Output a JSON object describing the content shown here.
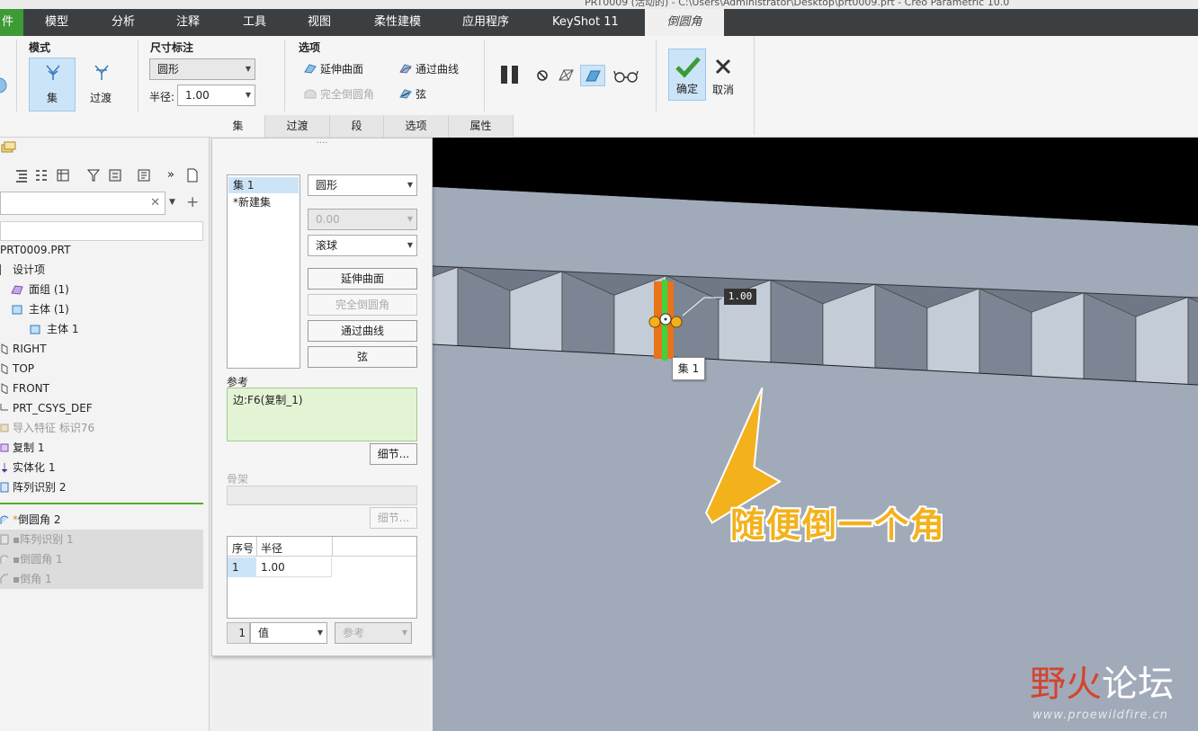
{
  "window": {
    "title": "PRT0009 (活动的) - C:\\Users\\Administrator\\Desktop\\prt0009.prt - Creo Parametric 10.0"
  },
  "menu": {
    "file": "件",
    "tabs": [
      "模型",
      "分析",
      "注释",
      "工具",
      "视图",
      "柔性建模",
      "应用程序",
      "KeyShot 11"
    ],
    "active_tab": "倒圆角"
  },
  "ribbon": {
    "mode": {
      "title": "模式",
      "set_label": "集",
      "transition_label": "过渡"
    },
    "dimension": {
      "title": "尺寸标注",
      "shape_value": "圆形",
      "radius_label": "半径:",
      "radius_value": "1.00"
    },
    "options": {
      "title": "选项",
      "extend_surface": "延伸曲面",
      "through_curve": "通过曲线",
      "full_round": "完全倒圆角",
      "chord": "弦"
    },
    "confirm_label": "确定",
    "cancel_label": "取消",
    "subtabs": [
      "集",
      "过渡",
      "段",
      "选项",
      "属性"
    ]
  },
  "tree": {
    "root": "PRT0009.PRT",
    "items": [
      "设计项",
      "面组 (1)",
      "主体 (1)",
      "主体 1",
      "RIGHT",
      "TOP",
      "FRONT",
      "PRT_CSYS_DEF",
      "导入特征 标识76",
      "复制 1",
      "实体化 1",
      "阵列识别 2",
      "倒圆角 2",
      "阵列识别 1",
      "倒圆角 1",
      "倒角 1"
    ]
  },
  "panel": {
    "grip": "····",
    "sets": [
      "集 1",
      "*新建集"
    ],
    "shape": "圆形",
    "value": "0.00",
    "method": "滚球",
    "btn_extend": "延伸曲面",
    "btn_full": "完全倒圆角",
    "btn_curve": "通过曲线",
    "btn_chord": "弦",
    "ref_label": "参考",
    "ref_value": "边:F6(复制_1)",
    "details": "细节...",
    "skeleton_label": "骨架",
    "table_headers": [
      "序号",
      "半径"
    ],
    "table_rows": [
      [
        "1",
        "1.00"
      ]
    ],
    "footer_num": "1",
    "footer_value": "值",
    "footer_ref": "参考"
  },
  "viewport": {
    "set_label": "集 1",
    "dim_value": "1.00",
    "annotation": "随便倒一个角",
    "watermark_a": "野火",
    "watermark_b": "论坛",
    "watermark_url": "www.proewildfire.cn"
  },
  "colors": {
    "menubar": "#3c3f41",
    "file_tab": "#3d9b35",
    "viewport": "#a0aab9",
    "annotation": "#f3b21c",
    "confirm": "#3d9b35",
    "highlight_edge": "#e9731a"
  }
}
